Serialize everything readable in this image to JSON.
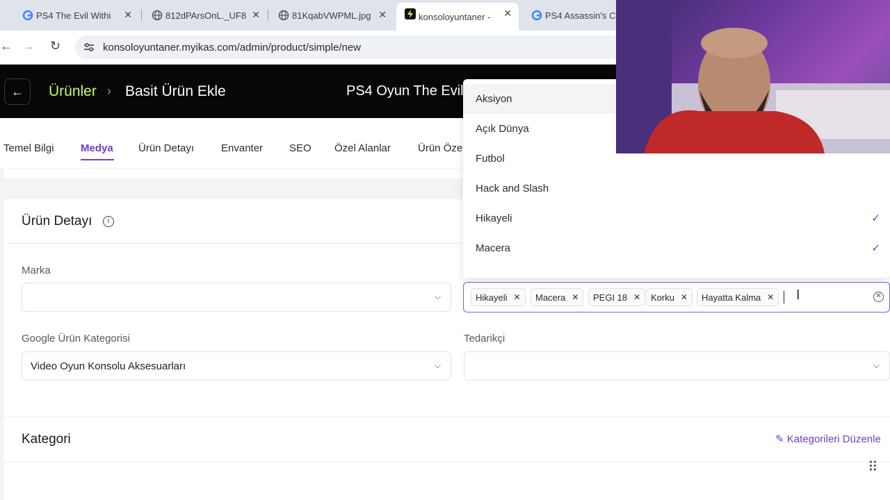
{
  "browser": {
    "tabs": [
      {
        "title": "PS4 The Evil Withi",
        "icon": "google-icon"
      },
      {
        "title": "812dPArsOnL._UF8",
        "icon": "globe-icon"
      },
      {
        "title": "81KqabVWPML.jpg",
        "icon": "globe-icon"
      },
      {
        "title": "konsoloyuntaner -",
        "icon": "bolt-icon"
      },
      {
        "title": "PS4 Assassin's Cre",
        "icon": "google-icon"
      }
    ],
    "url": "konsoloyuntaner.myikas.com/admin/product/simple/new"
  },
  "header": {
    "back": "←",
    "crumb_root": "Ürünler",
    "crumb_sep": "›",
    "crumb_current": "Basit Ürün Ekle",
    "product_title": "PS4 Oyun The Evil"
  },
  "nav_tabs": [
    "Temel Bilgi",
    "Medya",
    "Ürün Detayı",
    "Envanter",
    "SEO",
    "Özel Alanlar",
    "Ürün Öze"
  ],
  "product_detail": {
    "title": "Ürün Detayı",
    "brand_label": "Marka",
    "brand_value": "",
    "google_category_label": "Google Ürün Kategorisi",
    "google_category_value": "Video Oyun Konsolu Aksesuarları",
    "supplier_label": "Tedarikçi",
    "supplier_value": ""
  },
  "tags": {
    "selected": [
      "Hikayeli",
      "Macera",
      "PEGI 18",
      "Korku",
      "Hayatta Kalma"
    ],
    "options": [
      {
        "label": "Aksiyon",
        "checked": false
      },
      {
        "label": "Açık Dünya",
        "checked": false
      },
      {
        "label": "Futbol",
        "checked": false
      },
      {
        "label": "Hack and Slash",
        "checked": false
      },
      {
        "label": "Hikayeli",
        "checked": true
      },
      {
        "label": "Macera",
        "checked": true
      }
    ]
  },
  "category": {
    "title": "Kategori",
    "edit_link": "Kategorileri Düzenle"
  },
  "colors": {
    "accent": "#6b3fd6",
    "crumb": "#c8ff54",
    "header_bg": "#070707"
  }
}
